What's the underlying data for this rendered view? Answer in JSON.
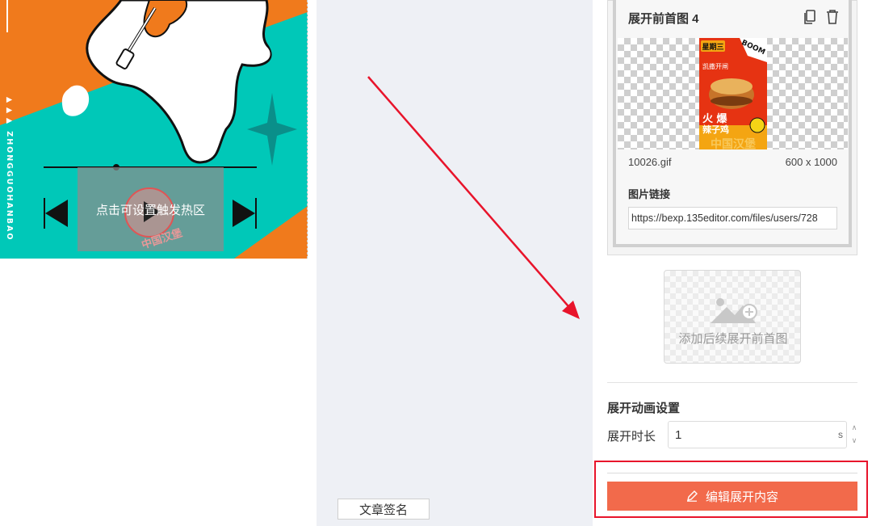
{
  "canvas": {
    "brand_vertical": "▶▶▶ ZHONGGUOHANBAO",
    "hotspot_label": "点击可设置触发热区",
    "stamp_text": "中国汉堡"
  },
  "footer": {
    "signature_button": "文章签名"
  },
  "image_card": {
    "title": "展开前首图 4",
    "copy_icon": "copy-icon",
    "delete_icon": "trash-icon",
    "file_name": "10026.gif",
    "file_size": "600 x 1000",
    "link_label": "图片链接",
    "link_value": "https://bexp.135editor.com/files/users/728",
    "thumbnail_text": {
      "badge": "星期三",
      "boom": "BOOM",
      "headline": "火 爆",
      "dish": "辣子鸡",
      "brand": "中国汉堡",
      "promo": "凯撒开闸"
    }
  },
  "add_tile": {
    "label": "添加后续展开前首图",
    "icon": "add-image-icon"
  },
  "animation": {
    "title": "展开动画设置",
    "duration_label": "展开时长",
    "duration_value": "1",
    "duration_unit": "s"
  },
  "action": {
    "edit_button": "编辑展开内容",
    "edit_icon": "pencil-icon"
  },
  "colors": {
    "accent_button": "#f26a4b",
    "highlight_box": "#e8142b",
    "arrow": "#e8142b",
    "poster_teal": "#00c8b8",
    "poster_orange": "#f07a1c"
  }
}
